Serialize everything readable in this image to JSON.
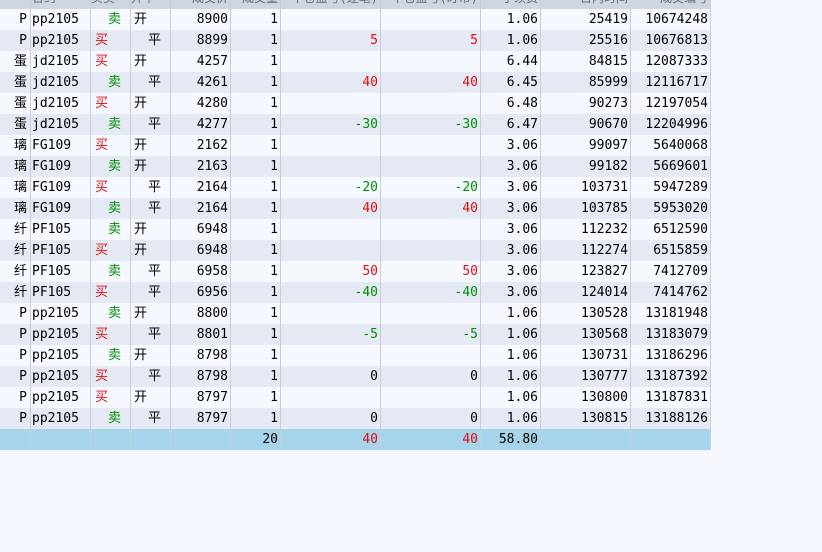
{
  "header": {
    "code": "合约",
    "dir": "买卖",
    "oc": "开平",
    "price": "成交价",
    "qty": "成交量",
    "p1": "平仓盈亏(逐笔)",
    "p2": "平仓盈亏(盯市)",
    "fee": "手续费",
    "time": "日内时间",
    "no": "成交编号"
  },
  "rows": [
    {
      "name": "P",
      "code": "pp2105",
      "dir": "卖",
      "oc": "开",
      "price": "8900",
      "qty": "1",
      "p1": "",
      "p2": "",
      "fee": "1.06",
      "time": "25419",
      "no": "10674248"
    },
    {
      "name": "P",
      "code": "pp2105",
      "dir": "买",
      "oc": "平",
      "price": "8899",
      "qty": "1",
      "p1": "5",
      "p2": "5",
      "fee": "1.06",
      "time": "25516",
      "no": "10676813"
    },
    {
      "name": "蛋",
      "code": "jd2105",
      "dir": "买",
      "oc": "开",
      "price": "4257",
      "qty": "1",
      "p1": "",
      "p2": "",
      "fee": "6.44",
      "time": "84815",
      "no": "12087333"
    },
    {
      "name": "蛋",
      "code": "jd2105",
      "dir": "卖",
      "oc": "平",
      "price": "4261",
      "qty": "1",
      "p1": "40",
      "p2": "40",
      "fee": "6.45",
      "time": "85999",
      "no": "12116717"
    },
    {
      "name": "蛋",
      "code": "jd2105",
      "dir": "买",
      "oc": "开",
      "price": "4280",
      "qty": "1",
      "p1": "",
      "p2": "",
      "fee": "6.48",
      "time": "90273",
      "no": "12197054"
    },
    {
      "name": "蛋",
      "code": "jd2105",
      "dir": "卖",
      "oc": "平",
      "price": "4277",
      "qty": "1",
      "p1": "-30",
      "p2": "-30",
      "fee": "6.47",
      "time": "90670",
      "no": "12204996"
    },
    {
      "name": "璃",
      "code": "FG109",
      "dir": "买",
      "oc": "开",
      "price": "2162",
      "qty": "1",
      "p1": "",
      "p2": "",
      "fee": "3.06",
      "time": "99097",
      "no": "5640068"
    },
    {
      "name": "璃",
      "code": "FG109",
      "dir": "卖",
      "oc": "开",
      "price": "2163",
      "qty": "1",
      "p1": "",
      "p2": "",
      "fee": "3.06",
      "time": "99182",
      "no": "5669601"
    },
    {
      "name": "璃",
      "code": "FG109",
      "dir": "买",
      "oc": "平",
      "price": "2164",
      "qty": "1",
      "p1": "-20",
      "p2": "-20",
      "fee": "3.06",
      "time": "103731",
      "no": "5947289"
    },
    {
      "name": "璃",
      "code": "FG109",
      "dir": "卖",
      "oc": "平",
      "price": "2164",
      "qty": "1",
      "p1": "40",
      "p2": "40",
      "fee": "3.06",
      "time": "103785",
      "no": "5953020"
    },
    {
      "name": "纤",
      "code": "PF105",
      "dir": "卖",
      "oc": "开",
      "price": "6948",
      "qty": "1",
      "p1": "",
      "p2": "",
      "fee": "3.06",
      "time": "112232",
      "no": "6512590"
    },
    {
      "name": "纤",
      "code": "PF105",
      "dir": "买",
      "oc": "开",
      "price": "6948",
      "qty": "1",
      "p1": "",
      "p2": "",
      "fee": "3.06",
      "time": "112274",
      "no": "6515859"
    },
    {
      "name": "纤",
      "code": "PF105",
      "dir": "卖",
      "oc": "平",
      "price": "6958",
      "qty": "1",
      "p1": "50",
      "p2": "50",
      "fee": "3.06",
      "time": "123827",
      "no": "7412709"
    },
    {
      "name": "纤",
      "code": "PF105",
      "dir": "买",
      "oc": "平",
      "price": "6956",
      "qty": "1",
      "p1": "-40",
      "p2": "-40",
      "fee": "3.06",
      "time": "124014",
      "no": "7414762"
    },
    {
      "name": "P",
      "code": "pp2105",
      "dir": "卖",
      "oc": "开",
      "price": "8800",
      "qty": "1",
      "p1": "",
      "p2": "",
      "fee": "1.06",
      "time": "130528",
      "no": "13181948"
    },
    {
      "name": "P",
      "code": "pp2105",
      "dir": "买",
      "oc": "平",
      "price": "8801",
      "qty": "1",
      "p1": "-5",
      "p2": "-5",
      "fee": "1.06",
      "time": "130568",
      "no": "13183079"
    },
    {
      "name": "P",
      "code": "pp2105",
      "dir": "卖",
      "oc": "开",
      "price": "8798",
      "qty": "1",
      "p1": "",
      "p2": "",
      "fee": "1.06",
      "time": "130731",
      "no": "13186296"
    },
    {
      "name": "P",
      "code": "pp2105",
      "dir": "买",
      "oc": "平",
      "price": "8798",
      "qty": "1",
      "p1": "0",
      "p2": "0",
      "fee": "1.06",
      "time": "130777",
      "no": "13187392"
    },
    {
      "name": "P",
      "code": "pp2105",
      "dir": "买",
      "oc": "开",
      "price": "8797",
      "qty": "1",
      "p1": "",
      "p2": "",
      "fee": "1.06",
      "time": "130800",
      "no": "13187831"
    },
    {
      "name": "P",
      "code": "pp2105",
      "dir": "卖",
      "oc": "平",
      "price": "8797",
      "qty": "1",
      "p1": "0",
      "p2": "0",
      "fee": "1.06",
      "time": "130815",
      "no": "13188126"
    }
  ],
  "total": {
    "qty": "20",
    "p1": "40",
    "p2": "40",
    "fee": "58.80"
  },
  "colors": {
    "buy": "#e01010",
    "sell": "#009000",
    "profit": "#e01010",
    "loss": "#009000",
    "total_row": "#a6d4ea"
  }
}
